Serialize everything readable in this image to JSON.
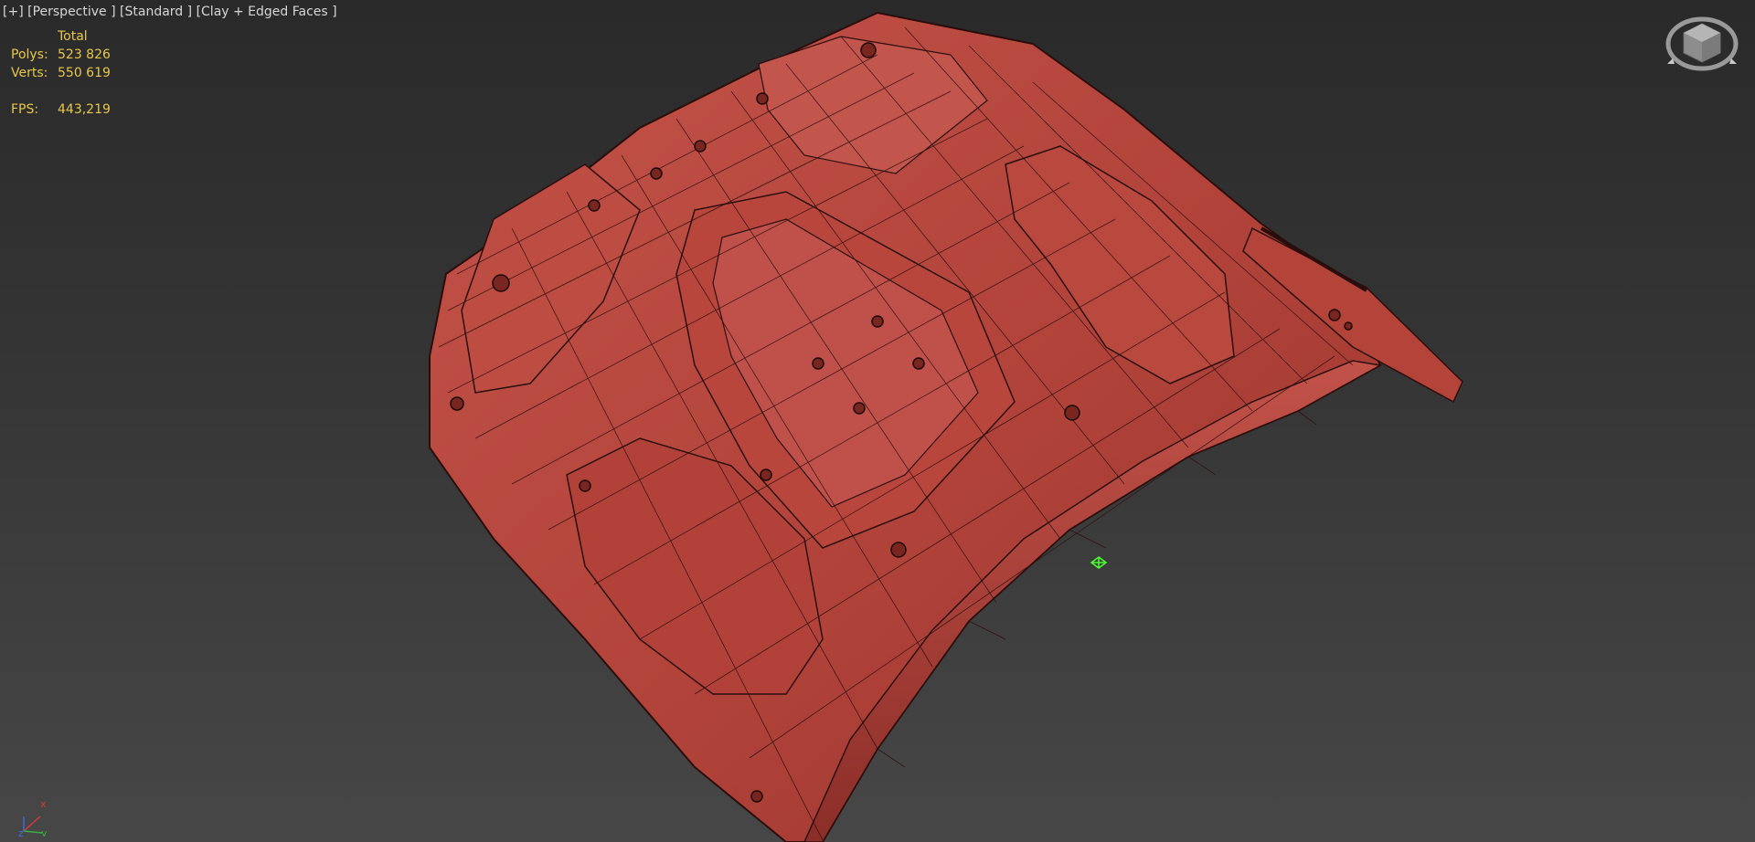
{
  "viewport": {
    "plus": "[+]",
    "view": "[Perspective ]",
    "shading_preset": "[Standard ]",
    "shading_mode": "[Clay + Edged Faces ]"
  },
  "stats": {
    "header": "Total",
    "polys_label": "Polys:",
    "polys_value": "523 826",
    "verts_label": "Verts:",
    "verts_value": "550 619",
    "fps_label": "FPS:",
    "fps_value": "443,219"
  },
  "axis": {
    "x": "x",
    "y": "y",
    "z": "z"
  },
  "icons": {
    "viewcube": "viewcube-icon",
    "axis_tripod": "axis-tripod-icon",
    "pivot": "pivot-gizmo-icon"
  },
  "colors": {
    "stats_text": "#e8c84a",
    "label_text": "#d6d6d6",
    "clay": "#b8473e",
    "clay_dark": "#8e2f29",
    "edges": "#2b0e0c",
    "pivot": "#4cff30"
  }
}
